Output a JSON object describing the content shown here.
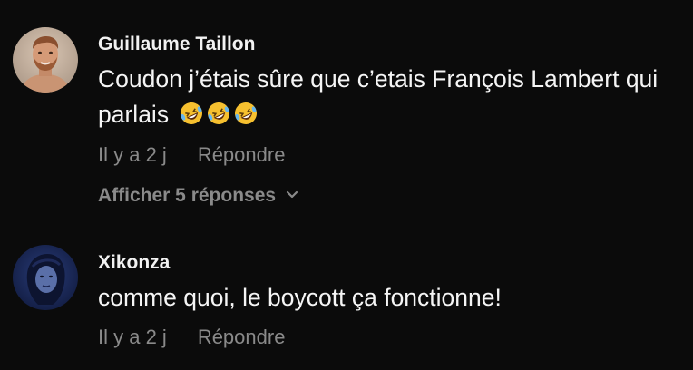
{
  "comments": [
    {
      "username": "Guillaume Taillon",
      "text": "Coudon j’étais sûre que c’etais François Lambert qui parlais",
      "emoji": [
        "rolling-on-floor-laughing-emoji",
        "rolling-on-floor-laughing-emoji",
        "rolling-on-floor-laughing-emoji"
      ],
      "time": "Il y a 2 j",
      "reply_label": "Répondre",
      "show_replies_label": "Afficher 5 réponses",
      "avatar": "avatar-man-beard"
    },
    {
      "username": "Xikonza",
      "text": "comme quoi, le boycott ça fonctionne!",
      "time": "Il y a 2 j",
      "reply_label": "Répondre",
      "avatar": "avatar-woman-blue"
    }
  ],
  "icons": {
    "chevron": "chevron-down-icon"
  },
  "colors": {
    "background": "#0b0b0b",
    "text_primary": "#f2f2f2",
    "text_secondary": "#8a8a8a",
    "emoji_yellow": "#f6c02f"
  }
}
